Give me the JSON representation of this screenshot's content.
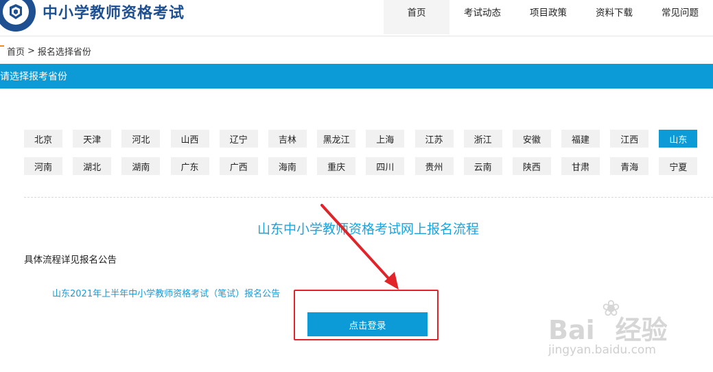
{
  "header": {
    "site_title": "中小学教师资格考试",
    "nav": [
      {
        "label": "首页",
        "active": true
      },
      {
        "label": "考试动态",
        "active": false
      },
      {
        "label": "项目政策",
        "active": false
      },
      {
        "label": "资料下载",
        "active": false
      },
      {
        "label": "常见问题",
        "active": false
      }
    ]
  },
  "breadcrumb": {
    "home": "首页",
    "separator": ">",
    "current": "报名选择省份"
  },
  "province_bar": {
    "label": "请选择报考省份"
  },
  "provinces": [
    {
      "name": "北京"
    },
    {
      "name": "天津"
    },
    {
      "name": "河北"
    },
    {
      "name": "山西"
    },
    {
      "name": "辽宁"
    },
    {
      "name": "吉林"
    },
    {
      "name": "黑龙江"
    },
    {
      "name": "上海"
    },
    {
      "name": "江苏"
    },
    {
      "name": "浙江"
    },
    {
      "name": "安徽"
    },
    {
      "name": "福建"
    },
    {
      "name": "江西"
    },
    {
      "name": "山东",
      "selected": true
    },
    {
      "name": "河南"
    },
    {
      "name": "湖北"
    },
    {
      "name": "湖南"
    },
    {
      "name": "广东"
    },
    {
      "name": "广西"
    },
    {
      "name": "海南"
    },
    {
      "name": "重庆"
    },
    {
      "name": "四川"
    },
    {
      "name": "贵州"
    },
    {
      "name": "云南"
    },
    {
      "name": "陕西"
    },
    {
      "name": "甘肃"
    },
    {
      "name": "青海"
    },
    {
      "name": "宁夏"
    }
  ],
  "main": {
    "flow_title": "山东中小学教师资格考试网上报名流程",
    "detail_text": "具体流程详见报名公告",
    "notice_link": "山东2021年上半年中小学教师资格考试（笔试）报名公告",
    "login_button": "点击登录"
  },
  "watermark": {
    "brand": "Bai",
    "brand_suffix": "经验",
    "url": "jingyan.baidu.com"
  },
  "colors": {
    "accent": "#0d9bd7",
    "title_blue": "#1d4f91",
    "annotation_red": "#e1232a"
  }
}
